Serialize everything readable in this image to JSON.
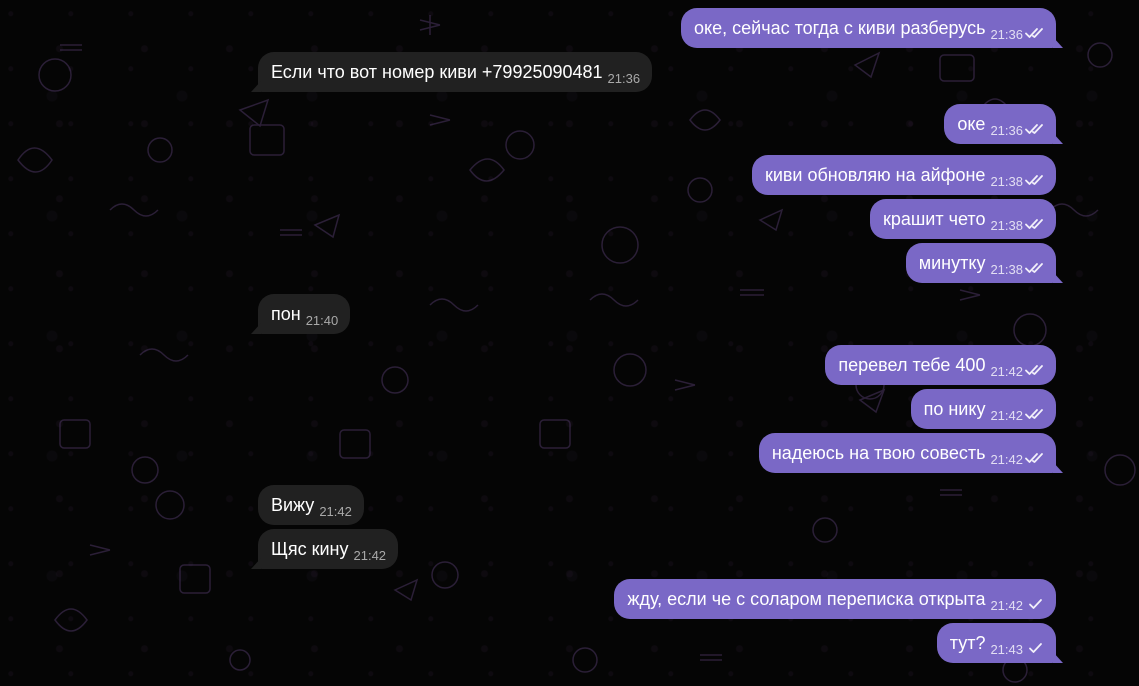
{
  "colors": {
    "background": "#050505",
    "outgoing_bubble": "#7a68c6",
    "incoming_bubble": "#212121",
    "doodle_stroke": "#4a3560"
  },
  "messages": [
    {
      "dir": "out",
      "text": "оке, сейчас тогда с киви разберусь",
      "time": "21:36",
      "status": "read-double-check-icon",
      "tail": true
    },
    {
      "dir": "in",
      "text": "Если что вот номер киви +79925090481",
      "time": "21:36",
      "tail": true
    },
    {
      "dir": "out",
      "text": "оке",
      "time": "21:36",
      "status": "read-double-check-icon",
      "tail": true
    },
    {
      "dir": "out",
      "text": "киви обновляю на айфоне",
      "time": "21:38",
      "status": "read-double-check-icon",
      "tail": false
    },
    {
      "dir": "out",
      "text": "крашит чето",
      "time": "21:38",
      "status": "read-double-check-icon",
      "tail": false
    },
    {
      "dir": "out",
      "text": "минутку",
      "time": "21:38",
      "status": "read-double-check-icon",
      "tail": true
    },
    {
      "dir": "in",
      "text": "пон",
      "time": "21:40",
      "tail": true
    },
    {
      "dir": "out",
      "text": "перевел тебе 400",
      "time": "21:42",
      "status": "read-double-check-icon",
      "tail": false
    },
    {
      "dir": "out",
      "text": "по нику",
      "time": "21:42",
      "status": "read-double-check-icon",
      "tail": false
    },
    {
      "dir": "out",
      "text": "надеюсь на твою совесть",
      "time": "21:42",
      "status": "read-double-check-icon",
      "tail": true
    },
    {
      "dir": "in",
      "text": "Вижу",
      "time": "21:42",
      "tail": false
    },
    {
      "dir": "in",
      "text": "Щяс кину",
      "time": "21:42",
      "tail": true
    },
    {
      "dir": "out",
      "text": "жду, если че с соларом переписка открыта",
      "time": "21:42",
      "status": "sent-single-check-icon",
      "tail": false
    },
    {
      "dir": "out",
      "text": "тут?",
      "time": "21:43",
      "status": "sent-single-check-icon",
      "tail": true
    }
  ]
}
